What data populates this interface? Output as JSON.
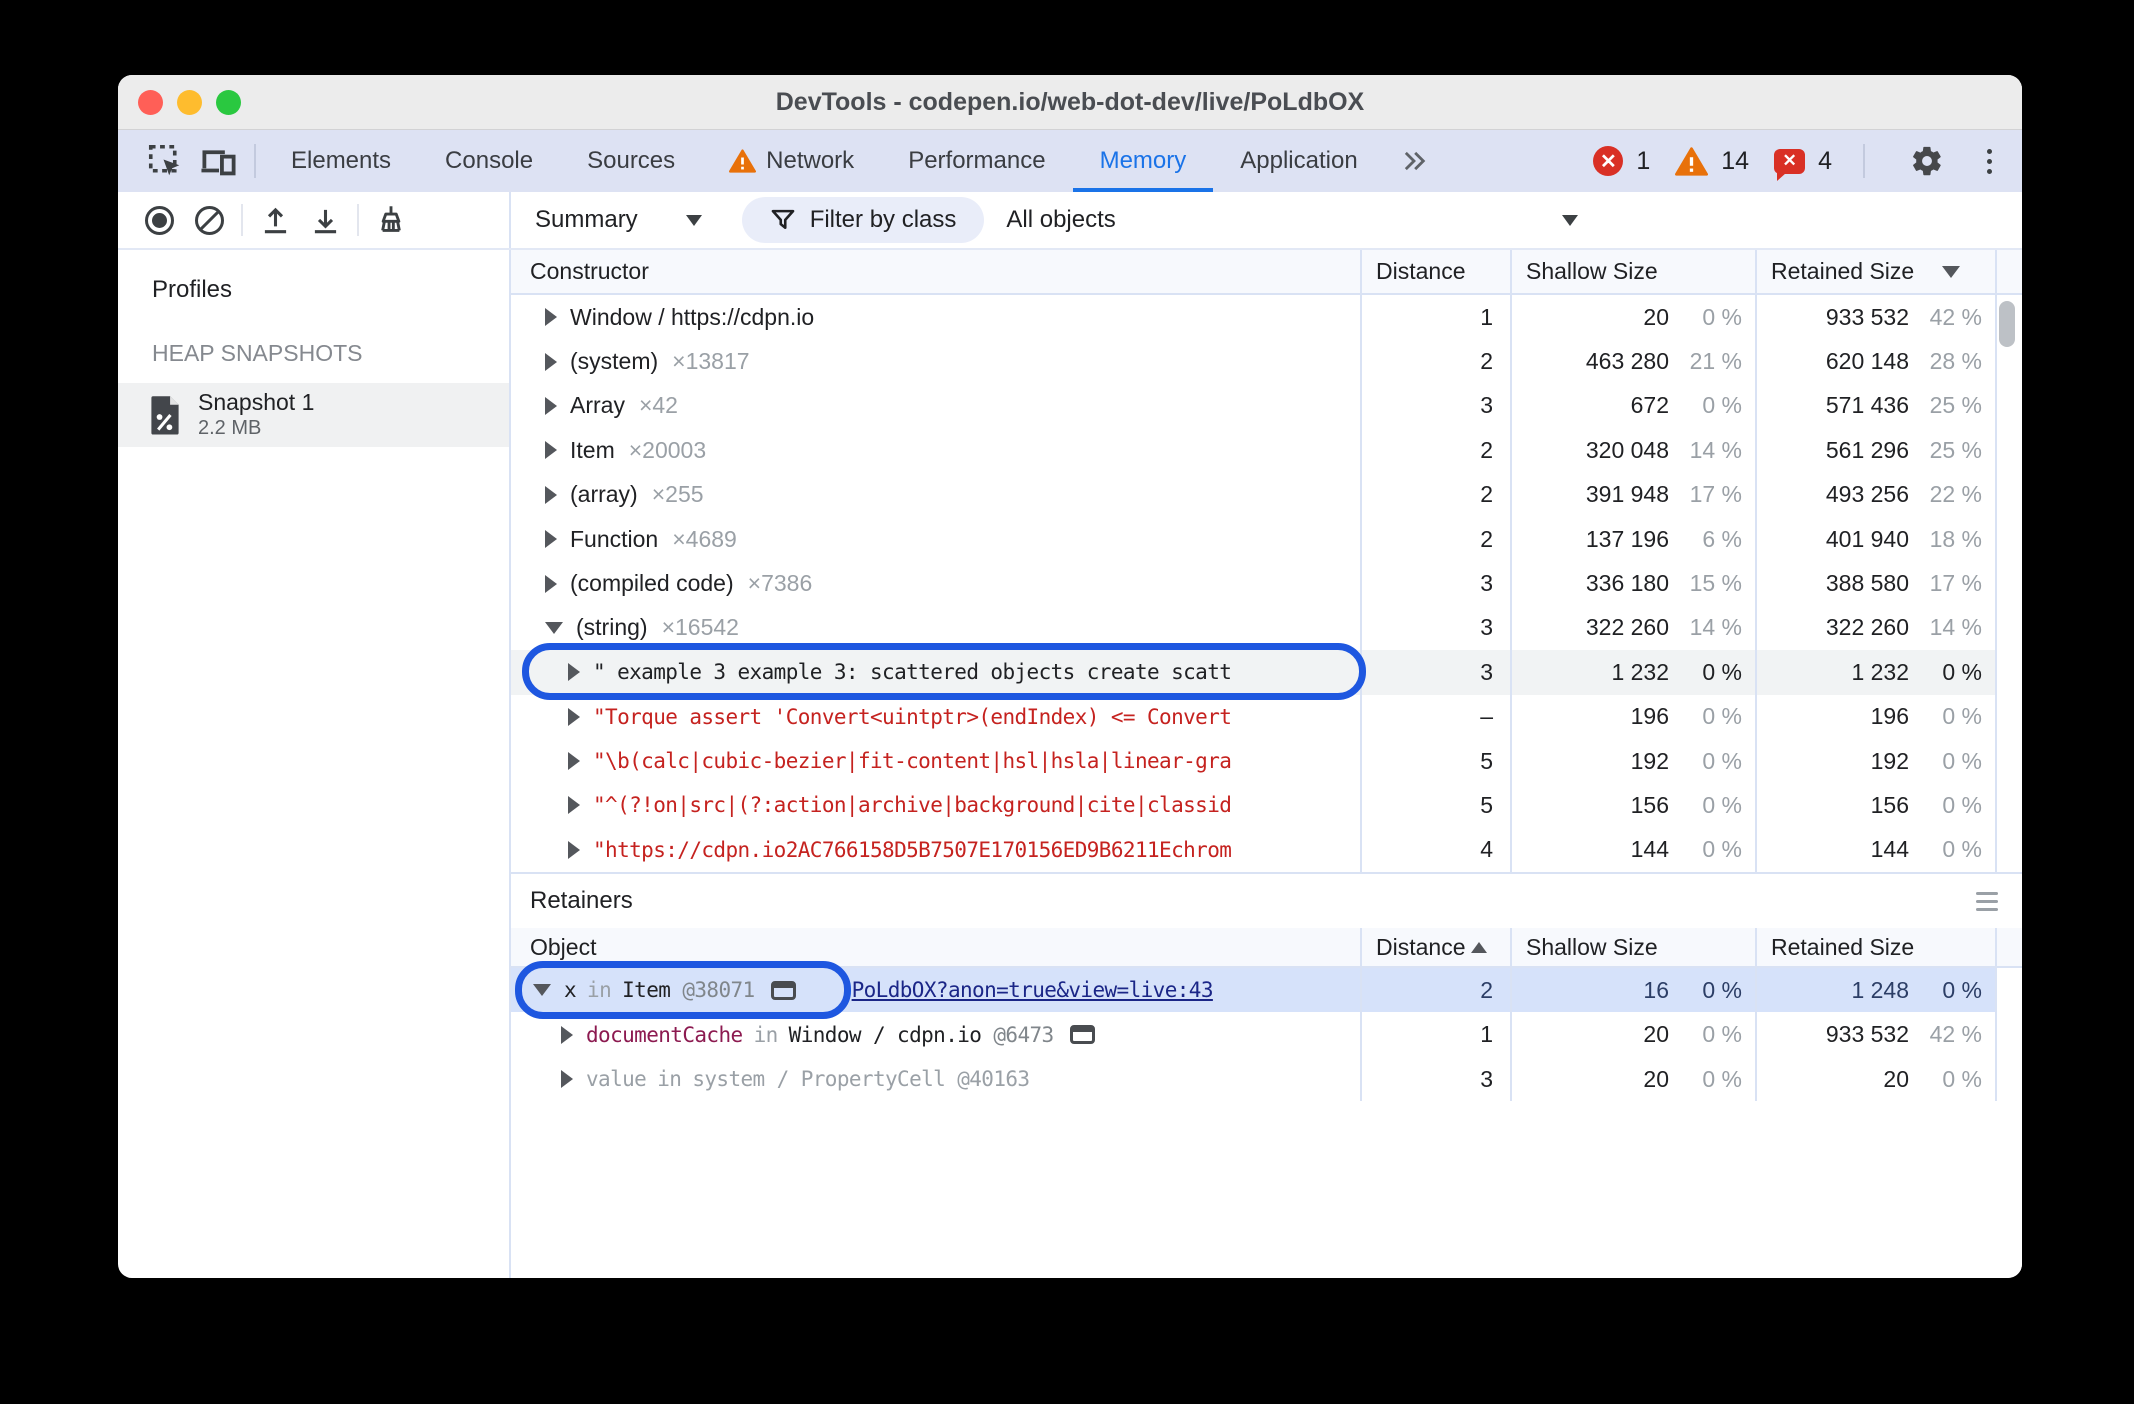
{
  "window": {
    "title": "DevTools - codepen.io/web-dot-dev/live/PoLdbOX"
  },
  "tab_bar": {
    "tabs": [
      {
        "label": "Elements"
      },
      {
        "label": "Console"
      },
      {
        "label": "Sources"
      },
      {
        "label": "Network",
        "warning": true
      },
      {
        "label": "Performance"
      },
      {
        "label": "Memory",
        "active": true
      },
      {
        "label": "Application"
      }
    ],
    "error_count": "1",
    "warning_count": "14",
    "issue_count": "4"
  },
  "toolbar": {
    "view_select": "Summary",
    "filter_button": "Filter by class",
    "class_select": "All objects"
  },
  "sidebar": {
    "heading": "Profiles",
    "section_label": "HEAP SNAPSHOTS",
    "snapshot_name": "Snapshot 1",
    "snapshot_size": "2.2 MB"
  },
  "constructors_table": {
    "columns": {
      "constructor": "Constructor",
      "distance": "Distance",
      "shallow": "Shallow Size",
      "retained": "Retained Size"
    },
    "rows": [
      {
        "name": "Window / https://cdpn.io",
        "count": "",
        "distance": "1",
        "shallow": "20",
        "shallow_pct": "0 %",
        "retained": "933 532",
        "retained_pct": "42 %"
      },
      {
        "name": "(system)",
        "count": "×13817",
        "distance": "2",
        "shallow": "463 280",
        "shallow_pct": "21 %",
        "retained": "620 148",
        "retained_pct": "28 %"
      },
      {
        "name": "Array",
        "count": "×42",
        "distance": "3",
        "shallow": "672",
        "shallow_pct": "0 %",
        "retained": "571 436",
        "retained_pct": "25 %"
      },
      {
        "name": "Item",
        "count": "×20003",
        "distance": "2",
        "shallow": "320 048",
        "shallow_pct": "14 %",
        "retained": "561 296",
        "retained_pct": "25 %"
      },
      {
        "name": "(array)",
        "count": "×255",
        "distance": "2",
        "shallow": "391 948",
        "shallow_pct": "17 %",
        "retained": "493 256",
        "retained_pct": "22 %"
      },
      {
        "name": "Function",
        "count": "×4689",
        "distance": "2",
        "shallow": "137 196",
        "shallow_pct": "6 %",
        "retained": "401 940",
        "retained_pct": "18 %"
      },
      {
        "name": "(compiled code)",
        "count": "×7386",
        "distance": "3",
        "shallow": "336 180",
        "shallow_pct": "15 %",
        "retained": "388 580",
        "retained_pct": "17 %"
      },
      {
        "name": "(string)",
        "count": "×16542",
        "expanded": true,
        "distance": "3",
        "shallow": "322 260",
        "shallow_pct": "14 %",
        "retained": "322 260",
        "retained_pct": "14 %"
      },
      {
        "name": "\" example 3 example 3: scattered objects create scatt",
        "child": true,
        "mono": "dark",
        "selected": true,
        "ring": true,
        "distance": "3",
        "shallow": "1 232",
        "shallow_pct": "0 %",
        "retained": "1 232",
        "retained_pct": "0 %"
      },
      {
        "name": "\"Torque assert 'Convert<uintptr>(endIndex) <= Convert",
        "child": true,
        "mono": "red",
        "distance": "–",
        "shallow": "196",
        "shallow_pct": "0 %",
        "retained": "196",
        "retained_pct": "0 %"
      },
      {
        "name": "\"\\b(calc|cubic-bezier|fit-content|hsl|hsla|linear-gra",
        "child": true,
        "mono": "red",
        "distance": "5",
        "shallow": "192",
        "shallow_pct": "0 %",
        "retained": "192",
        "retained_pct": "0 %"
      },
      {
        "name": "\"^(?!on|src|(?:action|archive|background|cite|classid",
        "child": true,
        "mono": "red",
        "distance": "5",
        "shallow": "156",
        "shallow_pct": "0 %",
        "retained": "156",
        "retained_pct": "0 %"
      },
      {
        "name": "\"https://cdpn.io2AC766158D5B7507E170156ED9B6211Echrom",
        "child": true,
        "mono": "red",
        "distance": "4",
        "shallow": "144",
        "shallow_pct": "0 %",
        "retained": "144",
        "retained_pct": "0 %"
      }
    ]
  },
  "retainers_table": {
    "title": "Retainers",
    "columns": {
      "object": "Object",
      "distance": "Distance",
      "shallow": "Shallow Size",
      "retained": "Retained Size"
    },
    "rows": [
      {
        "expanded": true,
        "property": "x",
        "property_kind": "plain",
        "connector": "in",
        "object_name": "Item",
        "object_id": "@38071",
        "reveal_icon": true,
        "link": "PoLdbOX?anon=true&view=live:43",
        "selected": true,
        "ring": true,
        "distance": "2",
        "shallow": "16",
        "shallow_pct": "0 %",
        "retained": "1 248",
        "retained_pct": "0 %"
      },
      {
        "expanded": false,
        "indent": true,
        "property": "documentCache",
        "property_kind": "accessor",
        "connector": "in",
        "object_name": "Window / cdpn.io",
        "object_id": "@6473",
        "reveal_icon": true,
        "distance": "1",
        "shallow": "20",
        "shallow_pct": "0 %",
        "retained": "933 532",
        "retained_pct": "42 %"
      },
      {
        "expanded": false,
        "indent": true,
        "dim": true,
        "property": "value",
        "property_kind": "plain",
        "connector": "in",
        "object_name": "system / PropertyCell",
        "object_id": "@40163",
        "distance": "3",
        "shallow": "20",
        "shallow_pct": "0 %",
        "retained": "20",
        "retained_pct": "0 %"
      }
    ]
  },
  "colors": {
    "accent_blue": "#1a73e8",
    "annotation_ring_blue": "#1e57e0",
    "selected_row_blue": "#d6e2fa",
    "string_red": "#c5221f",
    "property_maroon": "#8c1a50",
    "link_navy": "#1b2687",
    "error_red": "#d93025",
    "warning_orange": "#e8710a"
  }
}
